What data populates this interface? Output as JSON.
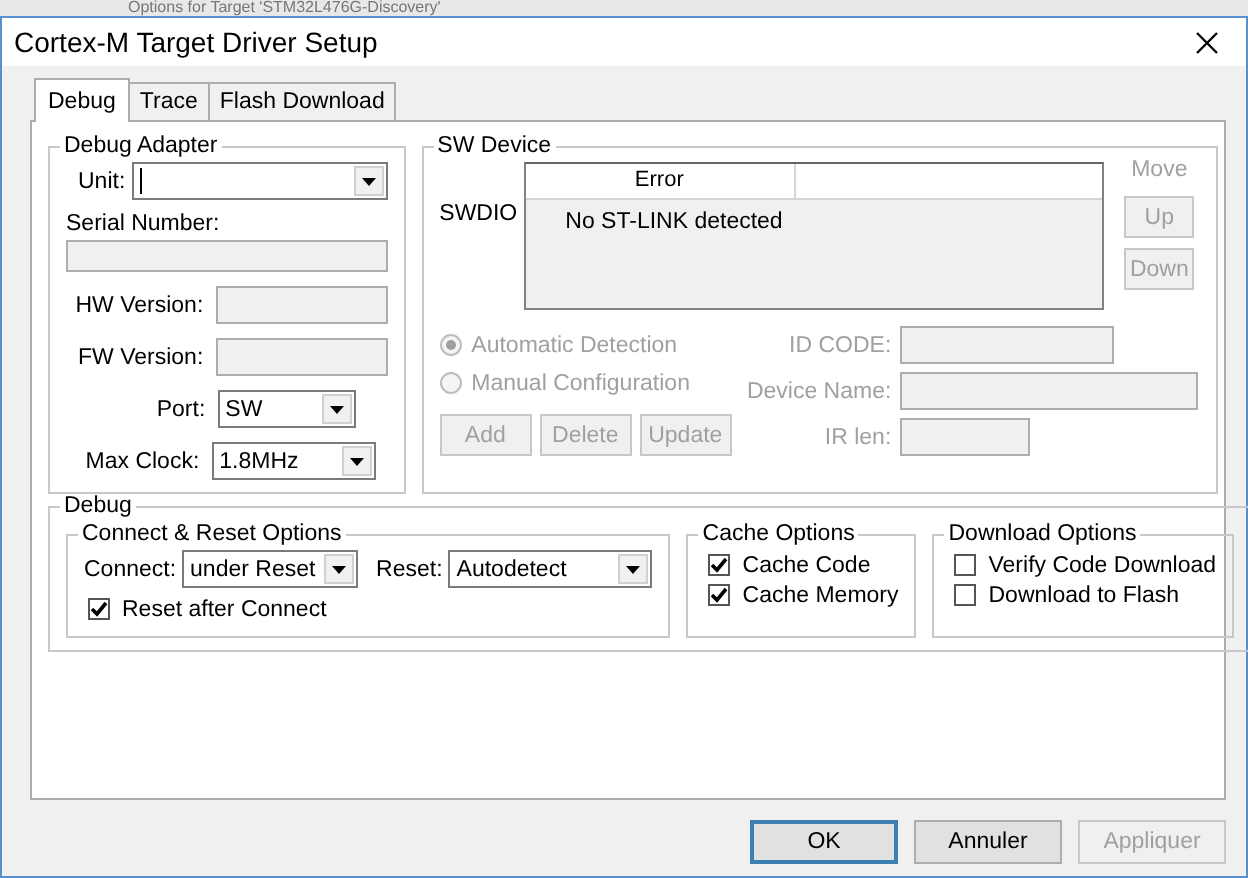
{
  "background_window": {
    "title": "Options for Target 'STM32L476G-Discovery'"
  },
  "window": {
    "title": "Cortex-M Target Driver Setup"
  },
  "tabs": [
    {
      "label": "Debug",
      "selected": true
    },
    {
      "label": "Trace",
      "selected": false
    },
    {
      "label": "Flash Download",
      "selected": false
    }
  ],
  "debug_adapter": {
    "title": "Debug Adapter",
    "unit": {
      "label": "Unit:"
    },
    "serial_number": {
      "label": "Serial Number:"
    },
    "hw_version": {
      "label": "HW Version:"
    },
    "fw_version": {
      "label": "FW Version:"
    },
    "port": {
      "label": "Port:",
      "value": "SW"
    },
    "max_clock": {
      "label": "Max Clock:",
      "value": "1.8MHz"
    }
  },
  "sw_device": {
    "title": "SW Device",
    "row_label": "SWDIO",
    "table": {
      "columns": [
        "Error"
      ],
      "rows": [
        [
          "No ST-LINK detected"
        ]
      ]
    },
    "move": {
      "label": "Move",
      "disabled": true
    },
    "move_buttons": [
      {
        "label": "Up",
        "disabled": true
      },
      {
        "label": "Down",
        "disabled": true
      }
    ],
    "detection": [
      {
        "label": "Automatic Detection",
        "selected": true,
        "disabled": true
      },
      {
        "label": "Manual Configuration",
        "selected": false,
        "disabled": true
      }
    ],
    "buttons": [
      {
        "label": "Add",
        "disabled": true
      },
      {
        "label": "Delete",
        "disabled": true
      },
      {
        "label": "Update",
        "disabled": true
      }
    ],
    "fields": [
      {
        "label": "ID CODE:",
        "disabled": true
      },
      {
        "label": "Device Name:",
        "disabled": true
      },
      {
        "label": "IR len:",
        "disabled": true
      }
    ]
  },
  "debug": {
    "title": "Debug",
    "connect_reset": {
      "title": "Connect & Reset Options",
      "connect": {
        "label": "Connect:",
        "value": "under Reset"
      },
      "reset": {
        "label": "Reset:",
        "value": "Autodetect"
      },
      "reset_after_connect": {
        "label": "Reset after Connect",
        "checked": true
      }
    },
    "cache_options": {
      "title": "Cache Options",
      "items": [
        {
          "label": "Cache Code",
          "checked": true
        },
        {
          "label": "Cache Memory",
          "checked": true
        }
      ]
    },
    "download_options": {
      "title": "Download Options",
      "items": [
        {
          "label": "Verify Code Download",
          "checked": false
        },
        {
          "label": "Download to Flash",
          "checked": false
        }
      ]
    }
  },
  "buttons": [
    {
      "label": "OK",
      "default": true,
      "disabled": false
    },
    {
      "label": "Annuler",
      "default": false,
      "disabled": false
    },
    {
      "label": "Appliquer",
      "default": false,
      "disabled": true
    }
  ]
}
